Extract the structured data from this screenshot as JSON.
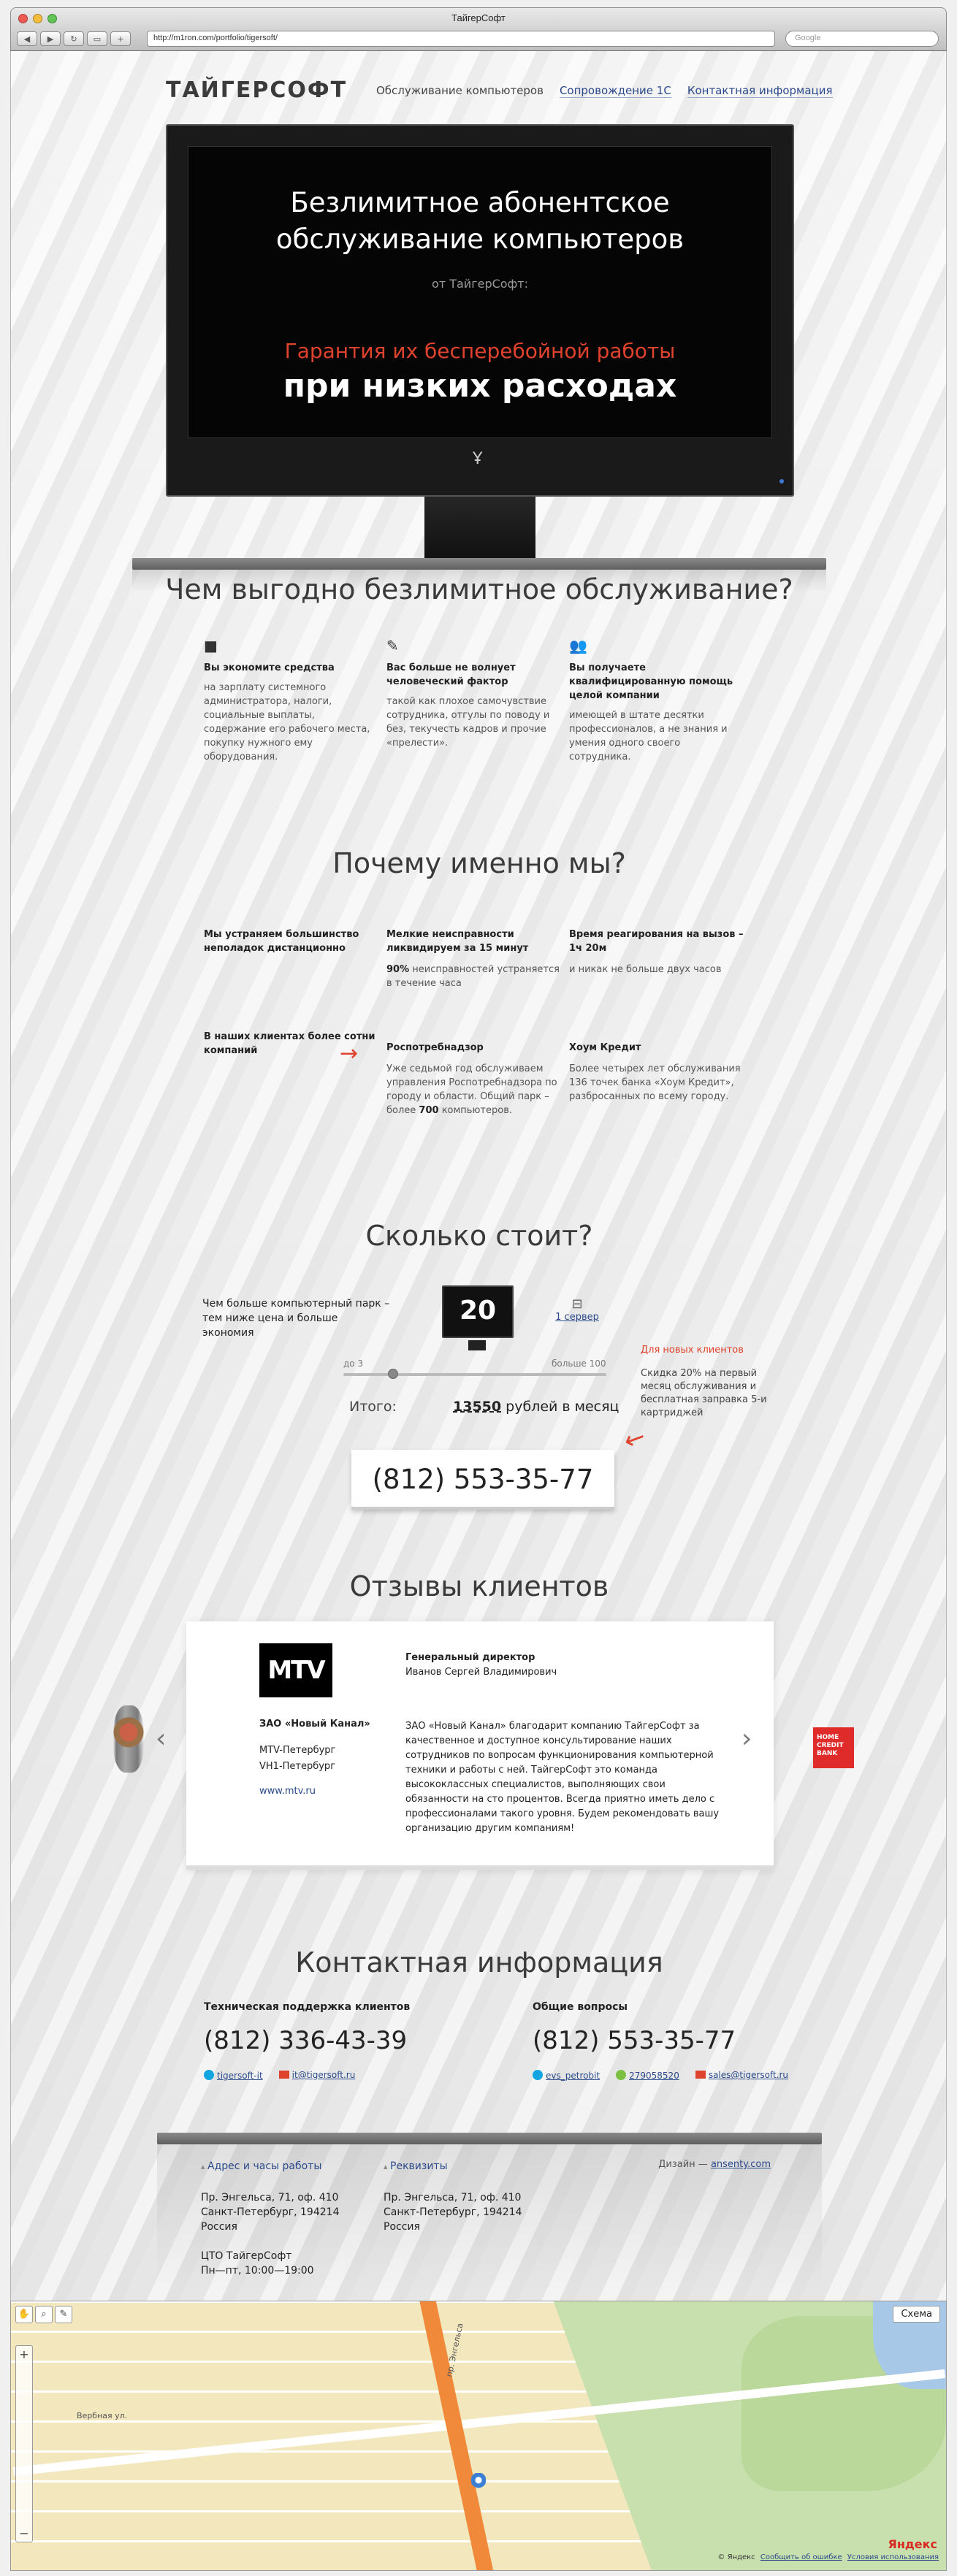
{
  "browser": {
    "title": "ТайгерСофт",
    "url": "http://m1ron.com/portfolio/tigersoft/",
    "search_placeholder": "Google"
  },
  "header": {
    "logo": "ТАЙГЕРСОФТ",
    "nav": [
      {
        "label": "Обслуживание компьютеров",
        "active": true
      },
      {
        "label": "Сопровождение 1С",
        "active": false
      },
      {
        "label": "Контактная информация",
        "active": false
      }
    ]
  },
  "hero": {
    "title_line1": "Безлимитное абонентское",
    "title_line2": "обслуживание компьютеров",
    "from": "от ТайгерСофт:",
    "guarantee": "Гарантия их бесперебойной работы",
    "low_cost": "при низких расходах"
  },
  "benefits": {
    "title": "Чем выгодно безлимитное обслуживание?",
    "items": [
      {
        "icon": "wallet-icon",
        "title": "Вы экономите средства",
        "text": "на зарплату системного администратора, налоги, социальные выплаты, содержание его рабочего места, покупку нужного ему оборудования."
      },
      {
        "icon": "pencil-icon",
        "title": "Вас больше не волнует человеческий фактор",
        "text": "такой как плохое самочувствие сотрудника, отгулы по поводу и без, текучесть кадров и прочие «прелести»."
      },
      {
        "icon": "people-icon",
        "title": "Вы получаете квалифицированную помощь целой компании",
        "text": "имеющей в штате десятки профессионалов, а не знания и умения одного своего сотрудника."
      }
    ]
  },
  "why_us": {
    "title": "Почему именно мы?",
    "items": [
      {
        "title": "Мы устраняем большинство неполадок дистанционно",
        "text": ""
      },
      {
        "title": "Мелкие неисправности ликвидируем за 15 минут",
        "bold": "90%",
        "text": " неисправностей устраняется в течение часа"
      },
      {
        "title": "Время реагирования на вызов – 1ч 20м",
        "text": "и никак не больше двух часов"
      },
      {
        "title": "В наших клиентах более сотни компаний",
        "text": ""
      },
      {
        "title": "Роспотребнадзор",
        "text": "Уже седьмой год обслуживаем управления Роспотребнадзора по городу и области. Общий парк – более ",
        "bold": "700",
        "text2": " компьютеров."
      },
      {
        "title": "Хоум Кредит",
        "text": "Более четырех лет обслуживания 136 точек банка «Хоум Кредит», разбросанных по всему городу."
      }
    ]
  },
  "pricing": {
    "title": "Сколько стоит?",
    "lead": "Чем больше компьютерный парк – тем ниже цена и больше экономия",
    "computers": "20",
    "server_label": "1 сервер",
    "slider_min": "до 3",
    "slider_max": "больше 100",
    "slider_value_fraction": 0.17,
    "total_label": "Итого:",
    "total_amount": "13550",
    "total_suffix": " рублей в месяц",
    "new_clients_title": "Для новых клиентов",
    "new_clients_text": "Скидка 20% на первый месяц обслуживания и бесплатная заправка 5-и картриджей",
    "phone": "(812) 553-35-77"
  },
  "reviews": {
    "title": "Отзывы клиентов",
    "logo_text": "MTV",
    "company": "ЗАО «Новый Канал»",
    "brand1": "MTV-Петербург",
    "brand2": "VH1-Петербург",
    "site": "www.mtv.ru",
    "person_title": "Генеральный директор",
    "person_name": "Иванов Сергей Владимирович",
    "text": "ЗАО «Новый Канал» благодарит компанию ТайгерСофт за качественное и доступное консультирование наших сотрудников по вопросам функционирования компьютерной техники и работы с ней. ТайгерСофт это команда высококлассных специалистов, выполняющих свои обязанности на сто процентов. Всегда приятно иметь дело с профессионалами такого уровня. Будем рекомендовать вашу организацию другим компаниям!",
    "next_logo_text": "HOME CREDIT BANK"
  },
  "contacts": {
    "title": "Контактная информация",
    "support": {
      "label": "Техническая поддержка клиентов",
      "phone": "(812) 336-43-39",
      "skype": "tigersoft-it",
      "email": "it@tigersoft.ru"
    },
    "general": {
      "label": "Общие вопросы",
      "phone": "(812) 553-35-77",
      "skype": "evs_petrobit",
      "icq": "279058520",
      "email": "sales@tigersoft.ru"
    }
  },
  "footer": {
    "address_title": "Адрес и часы работы",
    "address_lines": [
      "Пр. Энгельса, 71, оф. 410",
      "Санкт-Петербург, 194214",
      "Россия"
    ],
    "office_lines": [
      "ЦТО ТайгерСофт",
      "Пн—пт, 10:00—19:00"
    ],
    "requisites_title": "Реквизиты",
    "requisites_lines": [
      "Пр. Энгельса, 71, оф. 410",
      "Санкт-Петербург, 194214",
      "Россия"
    ],
    "design_label": "Дизайн — ",
    "design_link": "ansenty.com"
  },
  "map": {
    "scheme": "Схема",
    "copyright": "© Яндекс",
    "report": "Сообщить об ошибке",
    "terms": "Условия использования",
    "logo": "Яндекс",
    "street_a": "Вербная ул.",
    "street_b": "пр. Энгельса"
  }
}
